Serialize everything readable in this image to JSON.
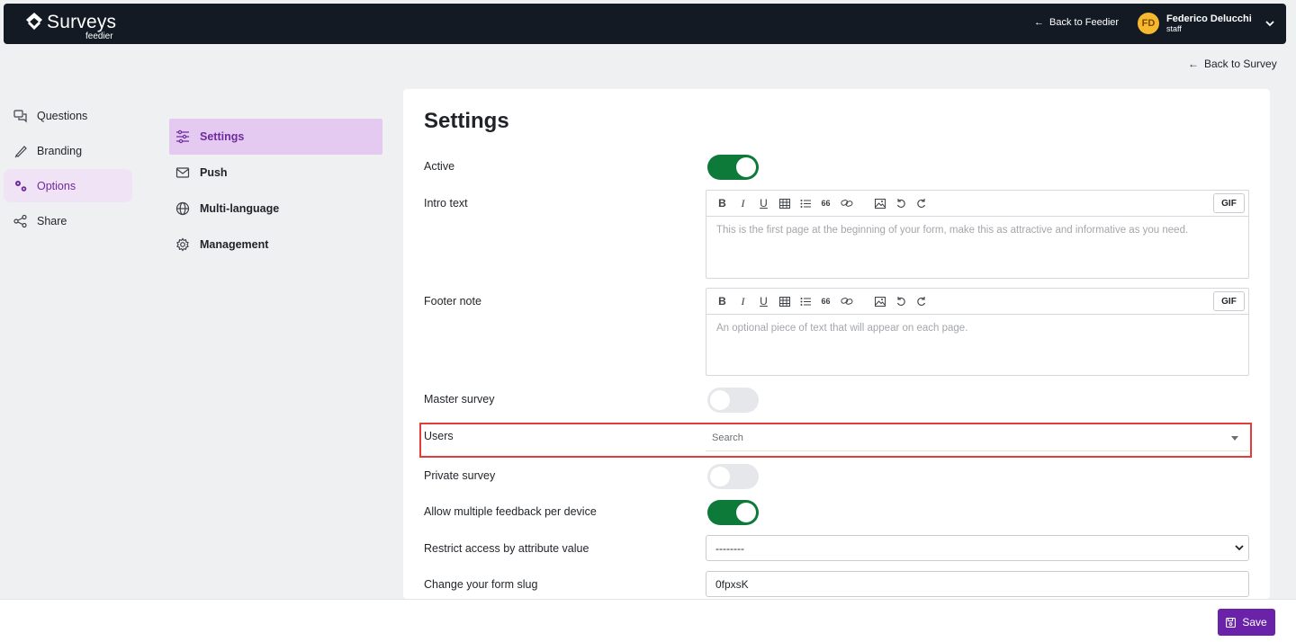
{
  "header": {
    "brand": "Surveys",
    "brand_sub": "feedier",
    "back_link": "Back to Feedier",
    "user": {
      "initials": "FD",
      "name": "Federico Delucchi",
      "role": "staff"
    }
  },
  "back_to_survey": "Back to Survey",
  "sidebar": {
    "items": [
      {
        "label": "Questions",
        "icon": "chat-bubbles-icon",
        "active": false
      },
      {
        "label": "Branding",
        "icon": "brush-icon",
        "active": false
      },
      {
        "label": "Options",
        "icon": "gears-icon",
        "active": true
      },
      {
        "label": "Share",
        "icon": "share-icon",
        "active": false
      }
    ]
  },
  "subnav": {
    "items": [
      {
        "label": "Settings",
        "icon": "sliders-icon",
        "active": true
      },
      {
        "label": "Push",
        "icon": "envelope-icon",
        "active": false
      },
      {
        "label": "Multi-language",
        "icon": "globe-icon",
        "active": false
      },
      {
        "label": "Management",
        "icon": "gear-icon",
        "active": false
      }
    ]
  },
  "settings": {
    "title": "Settings",
    "active": {
      "label": "Active",
      "value": true
    },
    "intro_text": {
      "label": "Intro text",
      "placeholder": "This is the first page at the beginning of your form, make this as attractive and informative as you need."
    },
    "footer_note": {
      "label": "Footer note",
      "placeholder": "An optional piece of text that will appear on each page."
    },
    "gif_label": "GIF",
    "master_survey": {
      "label": "Master survey",
      "value": false
    },
    "users": {
      "label": "Users",
      "placeholder": "Search"
    },
    "private_survey": {
      "label": "Private survey",
      "value": false
    },
    "allow_multiple": {
      "label": "Allow multiple feedback per device",
      "value": true
    },
    "restrict_access": {
      "label": "Restrict access by attribute value",
      "value": "--------"
    },
    "form_slug": {
      "label": "Change your form slug",
      "value": "0fpxsK"
    }
  },
  "toolbar": {
    "save_label": "Save"
  },
  "colors": {
    "accent": "#6a23a8",
    "toggle_on": "#0e7a3a",
    "highlight_border": "#e33a3a",
    "topbar": "#131a24"
  }
}
